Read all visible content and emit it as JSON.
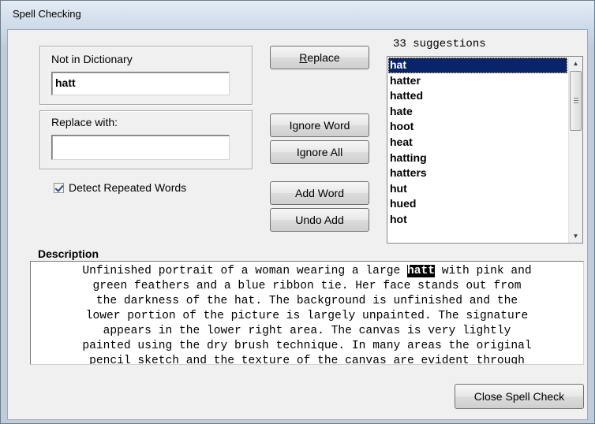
{
  "window": {
    "title": "Spell Checking"
  },
  "not_in_dictionary": {
    "label": "Not in Dictionary",
    "value": "hatt"
  },
  "replace_with": {
    "label": "Replace with:",
    "value": ""
  },
  "buttons": {
    "replace_prefix": "",
    "replace_mnemonic": "R",
    "replace_rest": "eplace",
    "ignore_word": "Ignore Word",
    "ignore_all": "Ignore All",
    "add_word": "Add Word",
    "undo_add": "Undo Add",
    "close_spell_check": "Close Spell Check"
  },
  "options": {
    "detect_repeated_words_label": "Detect Repeated Words",
    "detect_repeated_words_checked": true
  },
  "suggestions": {
    "title": "33 suggestions",
    "selected_index": 0,
    "items": [
      "hat",
      "hatter",
      "hatted",
      "hate",
      "hoot",
      "heat",
      "hatting",
      "hatters",
      "hut",
      "hued",
      "hot"
    ]
  },
  "description": {
    "label": "Description",
    "line1_before": "Unfinished portrait of a woman wearing a large ",
    "line1_highlight": "hatt",
    "line1_after": " with pink and",
    "lines": [
      "green feathers and a blue ribbon tie. Her face stands out from",
      "the darkness of the hat. The background is unfinished and the",
      "lower portion of the picture is largely unpainted. The signature",
      "appears in the lower right area. The canvas is very lightly",
      "painted using the dry brush technique. In many areas the original",
      "pencil sketch and the texture of the canvas are evident through"
    ]
  },
  "colors": {
    "selection_bg": "#0a246a",
    "highlight_bg": "#000000"
  }
}
